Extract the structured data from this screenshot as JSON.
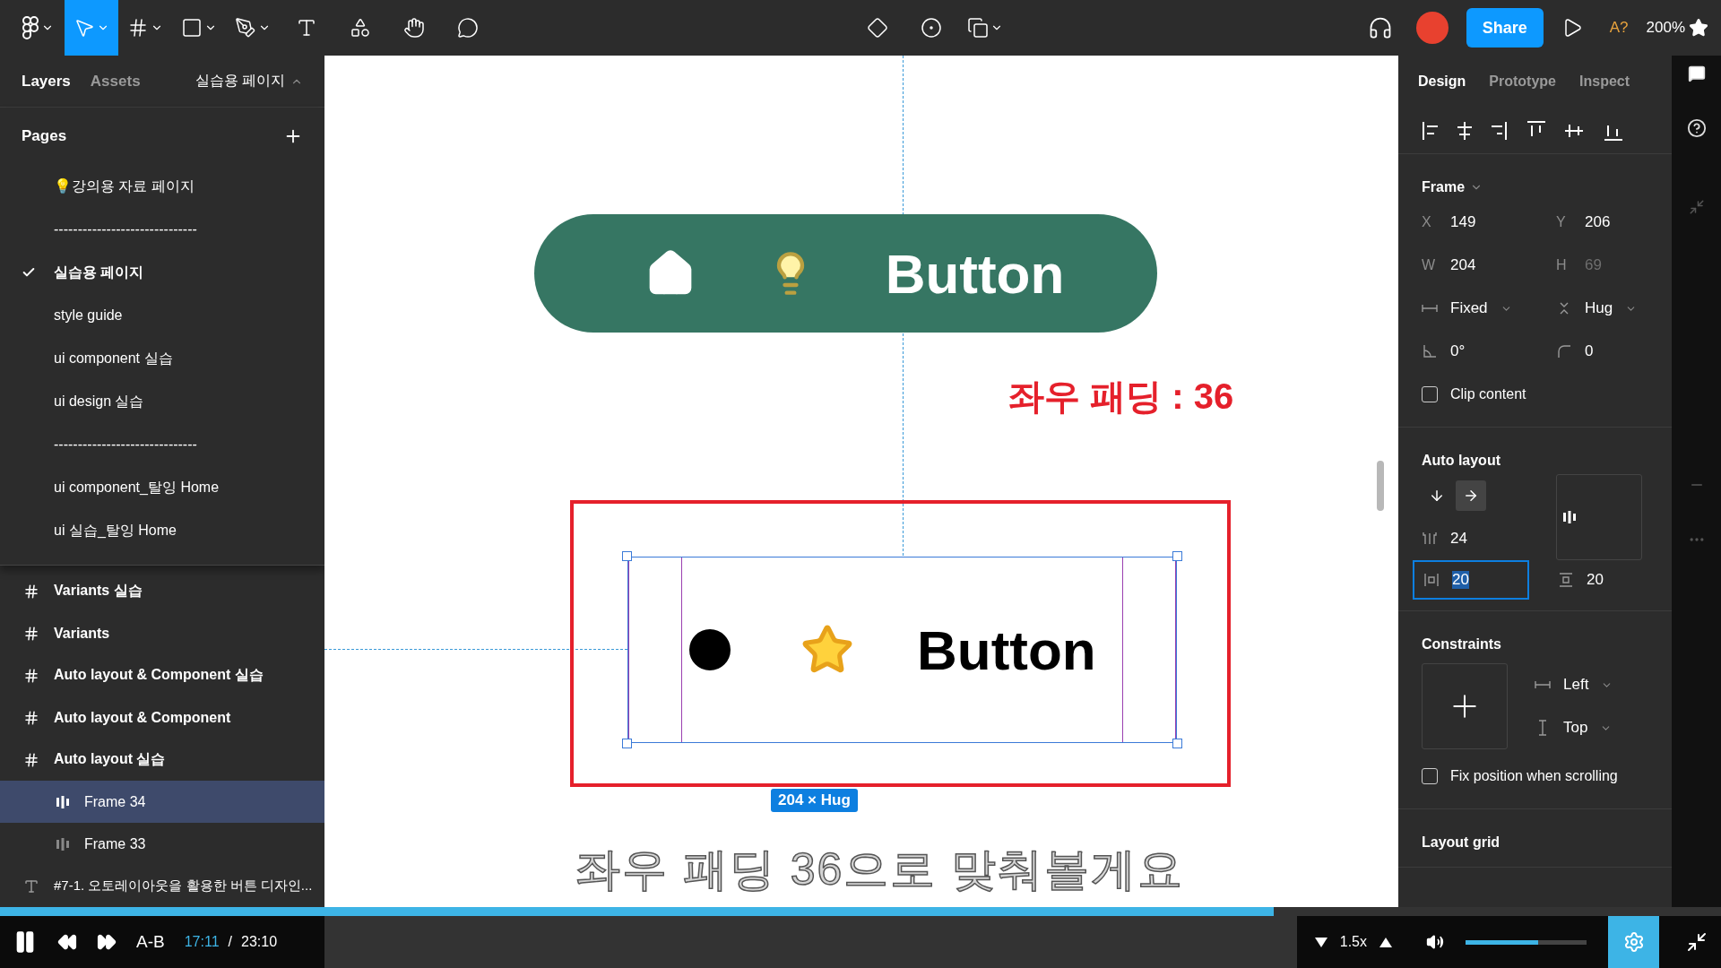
{
  "toolbar": {
    "tools": [
      {
        "kind": "move",
        "selected": true
      },
      {
        "kind": "frame",
        "selected": false
      },
      {
        "kind": "shape",
        "selected": false
      },
      {
        "kind": "pen",
        "selected": false
      },
      {
        "kind": "text",
        "selected": false
      },
      {
        "kind": "resources",
        "selected": false
      },
      {
        "kind": "hand",
        "selected": false
      },
      {
        "kind": "comment",
        "selected": false
      }
    ],
    "share": "Share",
    "font_warning": "A?",
    "zoom": "200%"
  },
  "left_panel": {
    "tabs": [
      {
        "label": "Layers",
        "selected": true
      },
      {
        "label": "Assets",
        "selected": false
      }
    ],
    "page_menu": "실습용 페이지",
    "pages_title": "Pages",
    "pages": [
      {
        "label": "💡강의용 자료 페이지",
        "checked": false
      },
      {
        "label": "------------------------------",
        "checked": false
      },
      {
        "label": "실습용 페이지",
        "checked": true
      },
      {
        "label": "style guide",
        "checked": false
      },
      {
        "label": "ui component 실습",
        "checked": false
      },
      {
        "label": "ui design 실습",
        "checked": false
      },
      {
        "label": "------------------------------",
        "checked": false
      },
      {
        "label": "ui component_탈잉 Home",
        "checked": false
      },
      {
        "label": "ui 실습_탈잉 Home",
        "checked": false
      }
    ],
    "layers": [
      {
        "kind": "frame",
        "label": "Variants 실습",
        "selected": false
      },
      {
        "kind": "frame",
        "label": "Variants",
        "selected": false
      },
      {
        "kind": "frame",
        "label": "Auto layout & Component 실습",
        "selected": false
      },
      {
        "kind": "frame",
        "label": "Auto layout & Component",
        "selected": false
      },
      {
        "kind": "frame",
        "label": "Auto layout 실습",
        "selected": false,
        "children": [
          {
            "kind": "autolayout",
            "label": "Frame 34",
            "selected": true
          },
          {
            "kind": "autolayout",
            "label": "Frame 33",
            "selected": false
          }
        ]
      },
      {
        "kind": "text",
        "label": "#7-1. 오토레이아웃을 활용한 버튼 디자인...",
        "selected": false
      }
    ]
  },
  "canvas": {
    "green_button": {
      "label": "Button"
    },
    "annotation": "좌우 패딩 : 36",
    "selected_button": {
      "label": "Button"
    },
    "size_badge": "204 × Hug",
    "subtitle": "좌우 패딩 36으로 맞춰볼게요"
  },
  "right_panel": {
    "tabs": [
      {
        "label": "Design",
        "selected": true
      },
      {
        "label": "Prototype",
        "selected": false
      },
      {
        "label": "Inspect",
        "selected": false
      }
    ],
    "frame_title": "Frame",
    "fields": [
      {
        "label": "X",
        "value": "149",
        "disabled": false
      },
      {
        "label": "Y",
        "value": "206",
        "disabled": false
      },
      {
        "label": "W",
        "value": "204",
        "disabled": false
      },
      {
        "label": "H",
        "value": "69",
        "disabled": true
      }
    ],
    "resizing": [
      {
        "kind": "horizontal",
        "value": "Fixed"
      },
      {
        "kind": "vertical",
        "value": "Hug"
      }
    ],
    "rotation": "0°",
    "radius": "0",
    "clip": {
      "label": "Clip content",
      "checked": false
    },
    "auto_layout": {
      "title": "Auto layout",
      "direction": [
        {
          "kind": "down",
          "selected": false
        },
        {
          "kind": "right",
          "selected": true
        }
      ],
      "spacing": "24",
      "padding": [
        {
          "kind": "horizontal",
          "value": "20",
          "focused": true
        },
        {
          "kind": "vertical",
          "value": "20",
          "focused": false
        }
      ]
    },
    "constraints": {
      "title": "Constraints",
      "horizontal": "Left",
      "vertical": "Top"
    },
    "fix_position": {
      "label": "Fix position when scrolling",
      "checked": false
    },
    "layout_grid": "Layout grid"
  },
  "player": {
    "playing": true,
    "ab": "A-B",
    "current": "17:11",
    "separator": "/",
    "total": "23:10",
    "speed": "1.5x",
    "progress": {
      "level": 0.74
    },
    "volume": {
      "level": 0.6
    }
  }
}
